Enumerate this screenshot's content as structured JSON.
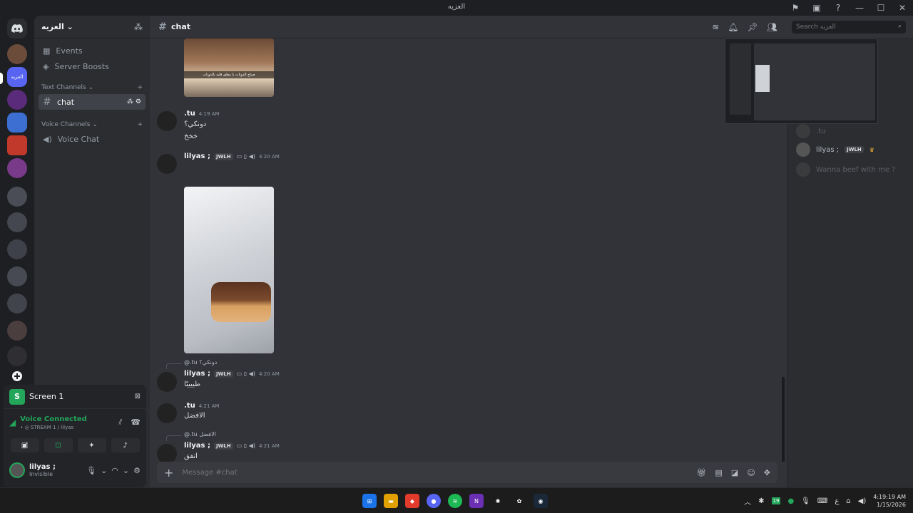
{
  "window": {
    "title": "العزيه"
  },
  "rail": {
    "active_server_label": "العزيه"
  },
  "sidebar": {
    "server_name": "العزيه",
    "items": [
      {
        "label": "Events",
        "icon": "calendar-icon"
      },
      {
        "label": "Server Boosts",
        "icon": "boost-icon"
      }
    ],
    "text_category": "Text Channels",
    "active_channel": "chat",
    "voice_category": "Voice Channels",
    "voice_channel": "Voice Chat"
  },
  "panel": {
    "screen_label": "Screen 1",
    "voice_status": "Voice Connected",
    "voice_sub": "• ◎ STREAM 1 / lilyas",
    "user_name": "lilyas ;",
    "user_status": "Invisible"
  },
  "header": {
    "channel": "chat",
    "search_placeholder": "Search العزيه"
  },
  "messages": [
    {
      "author": ".tu",
      "time": "4:19 AM",
      "lines": [
        "دونكي؟",
        "خخخ"
      ]
    },
    {
      "author": "lilyas ;",
      "tag": "JWLH",
      "time": "4:20 AM"
    },
    {
      "reply": "@.tu دونكي؟",
      "author": "lilyas ;",
      "tag": "JWLH",
      "time": "4:20 AM",
      "lines": [
        "طيييبًا"
      ]
    },
    {
      "author": ".tu",
      "time": "4:21 AM",
      "lines": [
        "الافضل"
      ]
    },
    {
      "reply": "@.tu الافضل",
      "author": "lilyas ;",
      "tag": "JWLH",
      "time": "4:21 AM",
      "lines": [
        "اتفق"
      ]
    }
  ],
  "image_caption": "صباح الدونات يا معلق قلبه بالدونات",
  "composer": {
    "placeholder": "Message #chat"
  },
  "members": [
    {
      "name": ".tu"
    },
    {
      "name": "lilyas ;",
      "tag": "JWLH"
    },
    {
      "name": "Wanna beef with me ?"
    }
  ],
  "taskbar": {
    "time": "4:19:19 AM",
    "date": "1/15/2026",
    "tray_lang": "ع",
    "badge": "19"
  }
}
